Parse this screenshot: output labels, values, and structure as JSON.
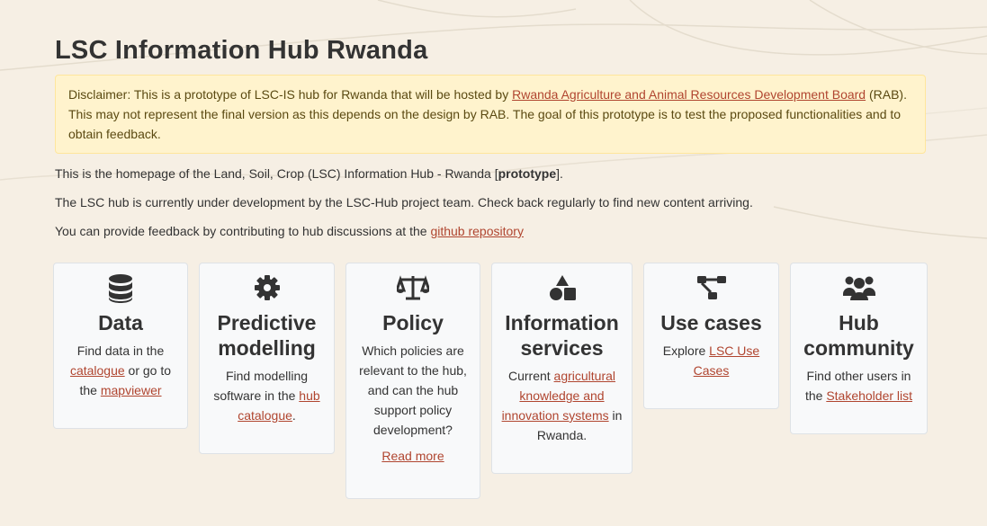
{
  "page_title": "LSC Information Hub Rwanda",
  "disclaimer": {
    "text_before": "Disclaimer: This is a prototype of LSC-IS hub for Rwanda that will be hosted by ",
    "link": "Rwanda Agriculture and Animal Resources Development Board",
    "text_after": " (RAB). This may not represent the final version as this depends on the design by RAB. The goal of this prototype is to test the proposed functionalities and to obtain feedback."
  },
  "intro": {
    "p1_before": "This is the homepage of the Land, Soil, Crop (LSC) Information Hub - Rwanda [",
    "p1_bold": "prototype",
    "p1_after": "].",
    "p2": "The LSC hub is currently under development by the LSC-Hub project team. Check back regularly to find new content arriving.",
    "p3_before": "You can provide feedback by contributing to hub discussions at the ",
    "p3_link": "github repository"
  },
  "cards": [
    {
      "icon": "database-icon",
      "title": "Data",
      "t1": "Find data in the ",
      "l1": "catalogue",
      "t2": " or go to the ",
      "l2": "mapviewer",
      "t3": ""
    },
    {
      "icon": "gear-icon",
      "title": "Predictive modelling",
      "t1": "Find modelling software in the ",
      "l1": "hub catalogue",
      "t2": "."
    },
    {
      "icon": "scale-icon",
      "title": "Policy",
      "t1": "Which policies are relevant to the hub, and can the hub support policy development?",
      "more": "Read more"
    },
    {
      "icon": "shapes-icon",
      "title": "Information services",
      "t1": "Current ",
      "l1": "agricultural knowledge and innovation systems",
      "t2": " in Rwanda."
    },
    {
      "icon": "diagram-icon",
      "title": "Use cases",
      "t1": "Explore ",
      "l1": "LSC Use Cases",
      "t2": ""
    },
    {
      "icon": "users-icon",
      "title": "Hub community",
      "t1": "Find other users in the ",
      "l1": "Stakeholder list",
      "t2": ""
    }
  ],
  "colors": {
    "background": "#f6efe4",
    "link": "#b0452f",
    "disclaimer_bg": "#fff3cd",
    "card_bg": "#f8f9fa"
  }
}
